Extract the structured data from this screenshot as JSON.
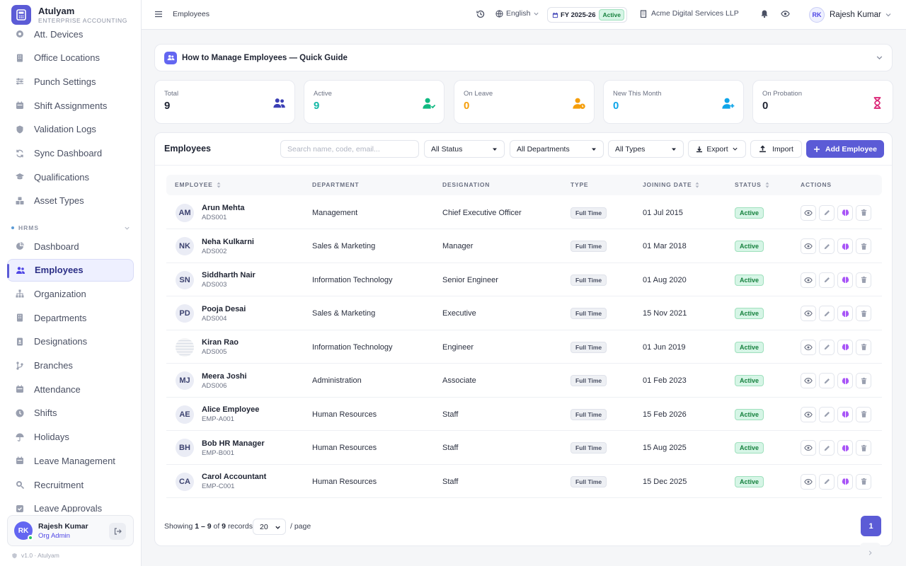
{
  "brand": {
    "name": "Atulyam",
    "sub": "ENTERPRISE ACCOUNTING"
  },
  "sidebar": {
    "items_top": [
      {
        "label": "Att. Devices",
        "icon": "device-icon"
      },
      {
        "label": "Office Locations",
        "icon": "building-icon"
      },
      {
        "label": "Punch Settings",
        "icon": "sliders-icon"
      },
      {
        "label": "Shift Assignments",
        "icon": "calendar-icon"
      },
      {
        "label": "Validation Logs",
        "icon": "shield-icon"
      },
      {
        "label": "Sync Dashboard",
        "icon": "sync-icon"
      },
      {
        "label": "Qualifications",
        "icon": "graduation-icon"
      },
      {
        "label": "Asset Types",
        "icon": "boxes-icon"
      }
    ],
    "section": "HRMS",
    "items_hrms": [
      {
        "label": "Dashboard",
        "icon": "pie-icon"
      },
      {
        "label": "Employees",
        "icon": "users-icon",
        "active": true
      },
      {
        "label": "Organization",
        "icon": "sitemap-icon"
      },
      {
        "label": "Departments",
        "icon": "building-icon"
      },
      {
        "label": "Designations",
        "icon": "id-badge-icon"
      },
      {
        "label": "Branches",
        "icon": "branch-icon"
      },
      {
        "label": "Attendance",
        "icon": "calendar-icon"
      },
      {
        "label": "Shifts",
        "icon": "clock-icon"
      },
      {
        "label": "Holidays",
        "icon": "umbrella-icon"
      },
      {
        "label": "Leave Management",
        "icon": "calendar-icon"
      },
      {
        "label": "Recruitment",
        "icon": "search-icon"
      },
      {
        "label": "Leave Approvals",
        "icon": "check-icon"
      }
    ],
    "user": {
      "initials": "RK",
      "name": "Rajesh Kumar",
      "role": "Org Admin"
    },
    "version": "v1.0 · Atulyam"
  },
  "header": {
    "breadcrumb": "Employees",
    "language": "English",
    "fy": "FY 2025-26",
    "fy_status": "Active",
    "company": "Acme Digital Services LLP",
    "user_initials": "RK",
    "user_name": "Rajesh Kumar"
  },
  "guide": {
    "title": "How to Manage Employees — Quick Guide"
  },
  "stats": [
    {
      "label": "Total",
      "value": "9",
      "color": "#1f2433",
      "icon": "users-icon",
      "icon_color": "#3b3fb5"
    },
    {
      "label": "Active",
      "value": "9",
      "color": "#14b8a6",
      "icon": "user-check-icon",
      "icon_color": "#10b981"
    },
    {
      "label": "On Leave",
      "value": "0",
      "color": "#f59e0b",
      "icon": "user-clock-icon",
      "icon_color": "#f59e0b"
    },
    {
      "label": "New This Month",
      "value": "0",
      "color": "#0ea5e9",
      "icon": "user-plus-icon",
      "icon_color": "#0ea5e9"
    },
    {
      "label": "On Probation",
      "value": "0",
      "color": "#1f2433",
      "icon": "hourglass-icon",
      "icon_color": "#db2777"
    }
  ],
  "panel": {
    "title": "Employees",
    "search_placeholder": "Search name, code, email...",
    "filter_status": "All Status",
    "filter_departments": "All Departments",
    "filter_types": "All Types",
    "export_label": "Export",
    "import_label": "Import",
    "add_label": "Add Employee"
  },
  "table": {
    "columns": [
      "EMPLOYEE",
      "DEPARTMENT",
      "DESIGNATION",
      "TYPE",
      "JOINING DATE",
      "STATUS",
      "ACTIONS"
    ],
    "rows": [
      {
        "initials": "AM",
        "name": "Arun Mehta",
        "code": "ADS001",
        "department": "Management",
        "designation": "Chief Executive Officer",
        "type": "Full Time",
        "joining": "01 Jul 2015",
        "status": "Active"
      },
      {
        "initials": "NK",
        "name": "Neha Kulkarni",
        "code": "ADS002",
        "department": "Sales & Marketing",
        "designation": "Manager",
        "type": "Full Time",
        "joining": "01 Mar 2018",
        "status": "Active"
      },
      {
        "initials": "SN",
        "name": "Siddharth Nair",
        "code": "ADS003",
        "department": "Information Technology",
        "designation": "Senior Engineer",
        "type": "Full Time",
        "joining": "01 Aug 2020",
        "status": "Active"
      },
      {
        "initials": "PD",
        "name": "Pooja Desai",
        "code": "ADS004",
        "department": "Sales & Marketing",
        "designation": "Executive",
        "type": "Full Time",
        "joining": "15 Nov 2021",
        "status": "Active"
      },
      {
        "initials": "",
        "photo": true,
        "name": "Kiran Rao",
        "code": "ADS005",
        "department": "Information Technology",
        "designation": "Engineer",
        "type": "Full Time",
        "joining": "01 Jun 2019",
        "status": "Active"
      },
      {
        "initials": "MJ",
        "name": "Meera Joshi",
        "code": "ADS006",
        "department": "Administration",
        "designation": "Associate",
        "type": "Full Time",
        "joining": "01 Feb 2023",
        "status": "Active"
      },
      {
        "initials": "AE",
        "name": "Alice Employee",
        "code": "EMP-A001",
        "department": "Human Resources",
        "designation": "Staff",
        "type": "Full Time",
        "joining": "15 Feb 2026",
        "status": "Active"
      },
      {
        "initials": "BH",
        "name": "Bob HR Manager",
        "code": "EMP-B001",
        "department": "Human Resources",
        "designation": "Staff",
        "type": "Full Time",
        "joining": "15 Aug 2025",
        "status": "Active"
      },
      {
        "initials": "CA",
        "name": "Carol Accountant",
        "code": "EMP-C001",
        "department": "Human Resources",
        "designation": "Staff",
        "type": "Full Time",
        "joining": "15 Dec 2025",
        "status": "Active"
      }
    ]
  },
  "footer": {
    "showing_prefix": "Showing",
    "range": "1 – 9",
    "of": "of",
    "total": "9",
    "records": "records",
    "per_page": "20",
    "per_page_label": "/ page",
    "current_page": "1"
  }
}
